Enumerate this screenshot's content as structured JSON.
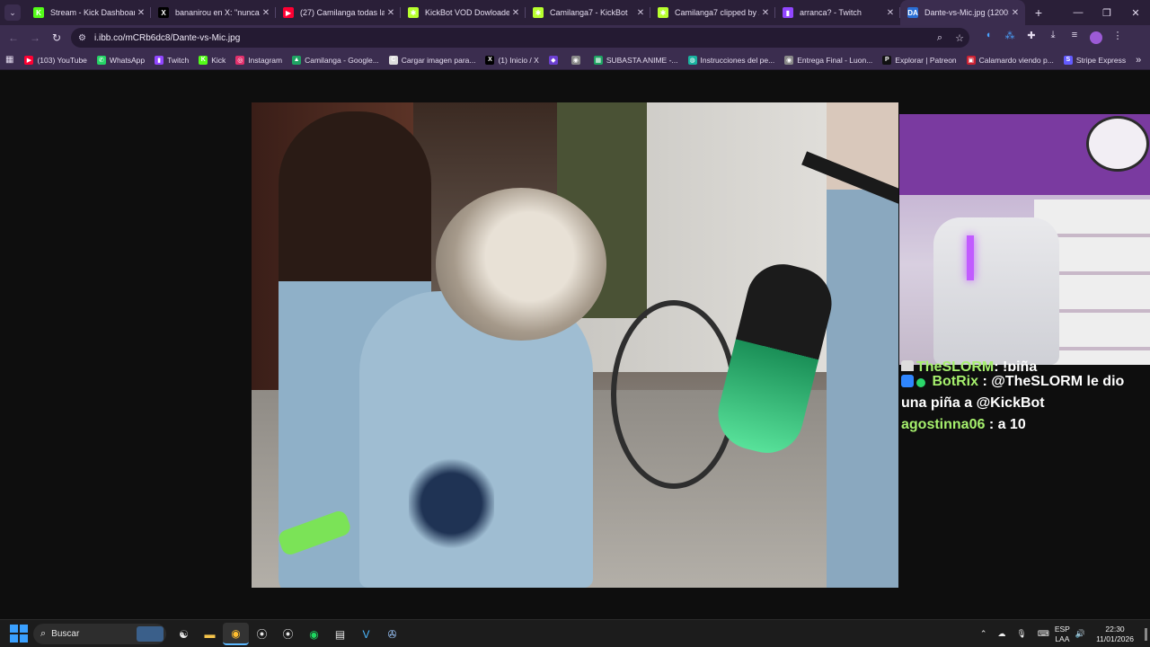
{
  "browser": {
    "tabs": [
      {
        "title": "Stream - Kick Dashboard",
        "favicon": "kick",
        "color": "#53fc18",
        "glyph": "K"
      },
      {
        "title": "bananirou en X: \"nunca pi...",
        "favicon": "x",
        "color": "#000000",
        "glyph": "X"
      },
      {
        "title": "(27) Camilanga todas las t...",
        "favicon": "youtube",
        "color": "#ff0033",
        "glyph": "▶"
      },
      {
        "title": "KickBot VOD Dowloader",
        "favicon": "kickbot",
        "color": "#b8ff2e",
        "glyph": "✱"
      },
      {
        "title": "Camilanga7 - KickBot",
        "favicon": "kickbot",
        "color": "#b8ff2e",
        "glyph": "✱"
      },
      {
        "title": "Camilanga7 clipped by Ze...",
        "favicon": "kickbot",
        "color": "#b8ff2e",
        "glyph": "✱"
      },
      {
        "title": "arranca? - Twitch",
        "favicon": "twitch",
        "color": "#9146ff",
        "glyph": "▮"
      },
      {
        "title": "Dante-vs-Mic.jpg (1200×...",
        "favicon": "ibb",
        "color": "#2a6fd6",
        "glyph": "DA",
        "active": true
      }
    ],
    "new_tab": "+",
    "window_controls": {
      "minimize": "—",
      "maximize": "❐",
      "close": "✕"
    },
    "url": "i.ibb.co/mCRb6dc8/Dante-vs-Mic.jpg",
    "bookmarks": [
      {
        "label": "(103) YouTube",
        "color": "#ff0033",
        "glyph": "▶"
      },
      {
        "label": "WhatsApp",
        "color": "#25d366",
        "glyph": "✆"
      },
      {
        "label": "Twitch",
        "color": "#9146ff",
        "glyph": "▮"
      },
      {
        "label": "Kick",
        "color": "#53fc18",
        "glyph": "K"
      },
      {
        "label": "Instagram",
        "color": "#e1306c",
        "glyph": "◎"
      },
      {
        "label": "Camilanga - Google...",
        "color": "#1fa463",
        "glyph": "▲"
      },
      {
        "label": "Cargar imagen para...",
        "color": "#dddddd",
        "glyph": "C"
      },
      {
        "label": "(1) Inicio / X",
        "color": "#000000",
        "glyph": "X"
      },
      {
        "label": "",
        "color": "#6b3fd1",
        "glyph": "◆"
      },
      {
        "label": "",
        "color": "#888888",
        "glyph": "◉"
      },
      {
        "label": "SUBASTA ANIME -...",
        "color": "#1fa463",
        "glyph": "▦"
      },
      {
        "label": "Instrucciones del pe...",
        "color": "#19b3a0",
        "glyph": "◍"
      },
      {
        "label": "Entrega Final - Luon...",
        "color": "#888888",
        "glyph": "◉"
      },
      {
        "label": "Explorar | Patreon",
        "color": "#111111",
        "glyph": "P"
      },
      {
        "label": "Calamardo viendo p...",
        "color": "#cc2233",
        "glyph": "▣"
      },
      {
        "label": "Stripe Express",
        "color": "#635bff",
        "glyph": "S"
      }
    ]
  },
  "chat": {
    "partial_line": {
      "user": "TheSLORM",
      "message": ": !piña"
    },
    "messages": [
      {
        "user": "BotRix",
        "message": ": @TheSLORM le dio una piña a @KickBot",
        "badge_color": "#2f86ff"
      },
      {
        "user": "agostinna06",
        "message": ": a 10"
      }
    ]
  },
  "taskbar": {
    "search_placeholder": "Buscar",
    "apps": [
      "widgets-icon",
      "chrome-icon",
      "files-icon",
      "chrome-profile-icon",
      "obs-icon",
      "obs2-icon",
      "spotify-icon",
      "recorder-icon",
      "vegas-icon",
      "steam-icon"
    ],
    "language": "ESP",
    "layout": "LAA",
    "time": "22:30",
    "date": "11/01/2026"
  }
}
